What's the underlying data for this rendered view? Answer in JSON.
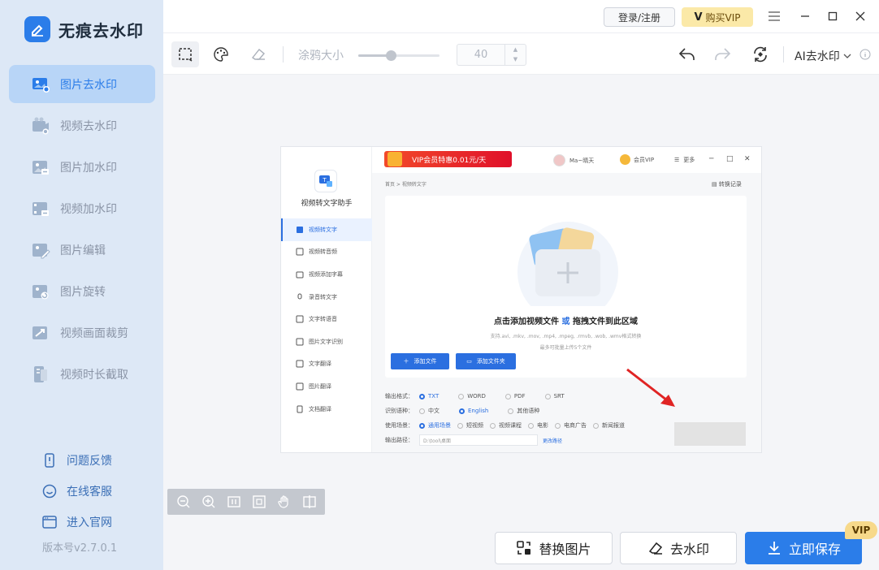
{
  "app": {
    "name": "无痕去水印",
    "version": "版本号v2.7.0.1"
  },
  "sidebar": {
    "items": [
      {
        "label": "图片去水印",
        "icon": "image-watermark-remove-icon",
        "active": true
      },
      {
        "label": "视频去水印",
        "icon": "video-watermark-remove-icon",
        "active": false
      },
      {
        "label": "图片加水印",
        "icon": "image-watermark-add-icon",
        "active": false
      },
      {
        "label": "视频加水印",
        "icon": "video-watermark-add-icon",
        "active": false
      },
      {
        "label": "图片编辑",
        "icon": "image-edit-icon",
        "active": false
      },
      {
        "label": "图片旋转",
        "icon": "image-rotate-icon",
        "active": false
      },
      {
        "label": "视频画面裁剪",
        "icon": "video-crop-icon",
        "active": false
      },
      {
        "label": "视频时长截取",
        "icon": "video-trim-icon",
        "active": false
      }
    ],
    "footer": [
      {
        "label": "问题反馈",
        "icon": "feedback-icon"
      },
      {
        "label": "在线客服",
        "icon": "customer-service-icon"
      },
      {
        "label": "进入官网",
        "icon": "website-icon"
      }
    ]
  },
  "topbar": {
    "login": "登录/注册",
    "vip": "购买VIP",
    "vip_mark": "V"
  },
  "toolbar": {
    "brush_label": "涂鸦大小",
    "brush_size": "40",
    "brush_level": 0.4,
    "ai_label": "AI去水印"
  },
  "screenshot": {
    "app_name": "视频转文字助手",
    "promo": "VIP会员特惠0.01元/天",
    "user": "Ma~晴天",
    "vip": "会员VIP",
    "more": "更多",
    "breadcrumb": "首页 > 视频转文字",
    "record": "转换记录",
    "menu": [
      {
        "label": "视频转文字",
        "active": true
      },
      {
        "label": "视频转音频",
        "active": false
      },
      {
        "label": "视频添加字幕",
        "active": false
      },
      {
        "label": "录音转文字",
        "active": false
      },
      {
        "label": "文字转语音",
        "active": false
      },
      {
        "label": "图片文字识别",
        "active": false
      },
      {
        "label": "文字翻译",
        "active": false
      },
      {
        "label": "图片翻译",
        "active": false
      },
      {
        "label": "文档翻译",
        "active": false
      }
    ],
    "drop_title_a": "点击添加视频文件",
    "drop_title_or": "或",
    "drop_title_b": "拖拽文件到此区域",
    "drop_formats": "支持.avi, .mkv, .mov, .mp4, .mpeg, .rmvb, .wob, .wmv格式转换",
    "drop_max": "最多可批量上传5个文件",
    "add_file": "添加文件",
    "add_folder": "添加文件夹",
    "output_format_label": "输出格式：",
    "output_formats": [
      {
        "label": "TXT",
        "on": true
      },
      {
        "label": "WORD",
        "on": false
      },
      {
        "label": "PDF",
        "on": false
      },
      {
        "label": "SRT",
        "on": false
      }
    ],
    "lang_label": "识别语种：",
    "langs": [
      {
        "label": "中文",
        "on": false
      },
      {
        "label": "English",
        "on": true
      },
      {
        "label": "其他语种",
        "on": false
      }
    ],
    "scene_label": "使用场景：",
    "scenes": [
      {
        "label": "通用场景",
        "on": true
      },
      {
        "label": "短视频",
        "on": false
      },
      {
        "label": "视频课程",
        "on": false
      },
      {
        "label": "电影",
        "on": false
      },
      {
        "label": "电商广告",
        "on": false
      },
      {
        "label": "新闻报道",
        "on": false
      }
    ],
    "path_label": "输出路径：",
    "path_value": "D:\\tool\\桌面",
    "path_change": "更改路径"
  },
  "actions": {
    "replace": "替换图片",
    "remove": "去水印",
    "save": "立即保存",
    "vip_tag": "VIP"
  },
  "colors": {
    "accent": "#2b7de9",
    "sidebar_bg": "#dde8f6",
    "active_bg": "#b8d5f7",
    "arrow": "#e02424"
  }
}
